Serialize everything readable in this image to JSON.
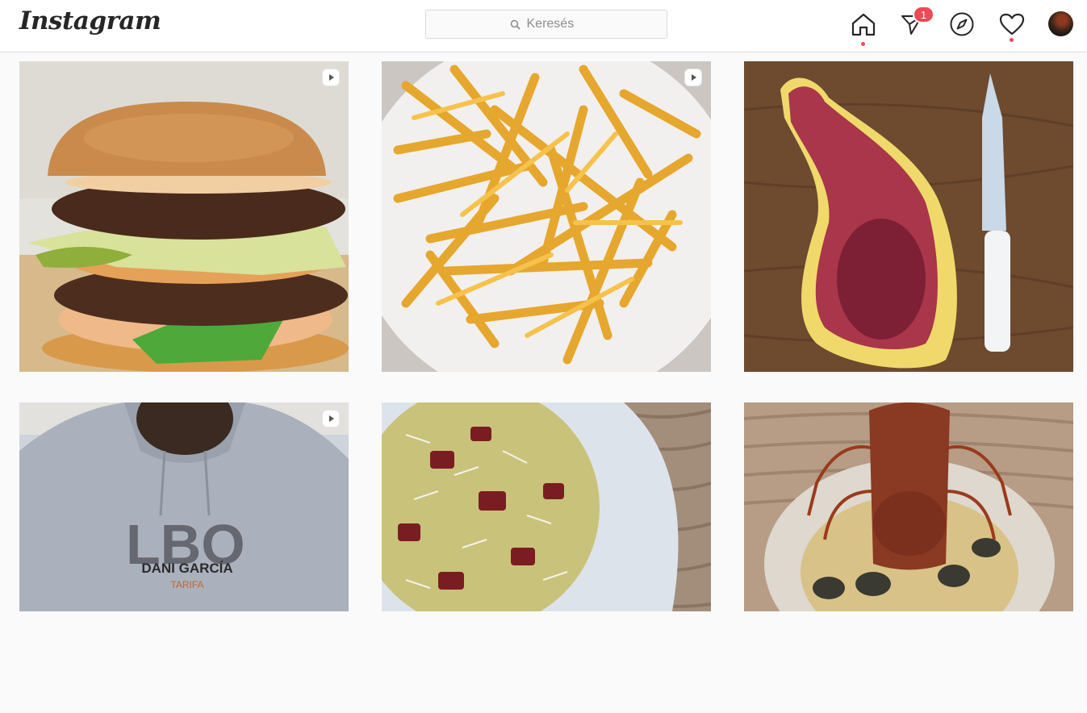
{
  "app": {
    "logo": "Instagram"
  },
  "search": {
    "placeholder": "Keresés"
  },
  "nav": {
    "icons": [
      "home-icon",
      "direct-messages-icon",
      "explore-icon",
      "activity-heart-icon",
      "profile-avatar"
    ],
    "messages_badge": "1"
  },
  "colors": {
    "notification": "#ed4956",
    "border": "#dbdbdb",
    "background": "#fafafa"
  },
  "grid": {
    "posts": [
      {
        "subject": "burger",
        "type": "reel"
      },
      {
        "subject": "fries",
        "type": "reel"
      },
      {
        "subject": "steak-knife",
        "type": "photo"
      },
      {
        "subject": "hoodie",
        "type": "reel",
        "hoodie_line1": "DANI GARCÍA",
        "hoodie_line2": "TARIFA"
      },
      {
        "subject": "pasta",
        "type": "photo"
      },
      {
        "subject": "lobster",
        "type": "photo"
      }
    ]
  }
}
